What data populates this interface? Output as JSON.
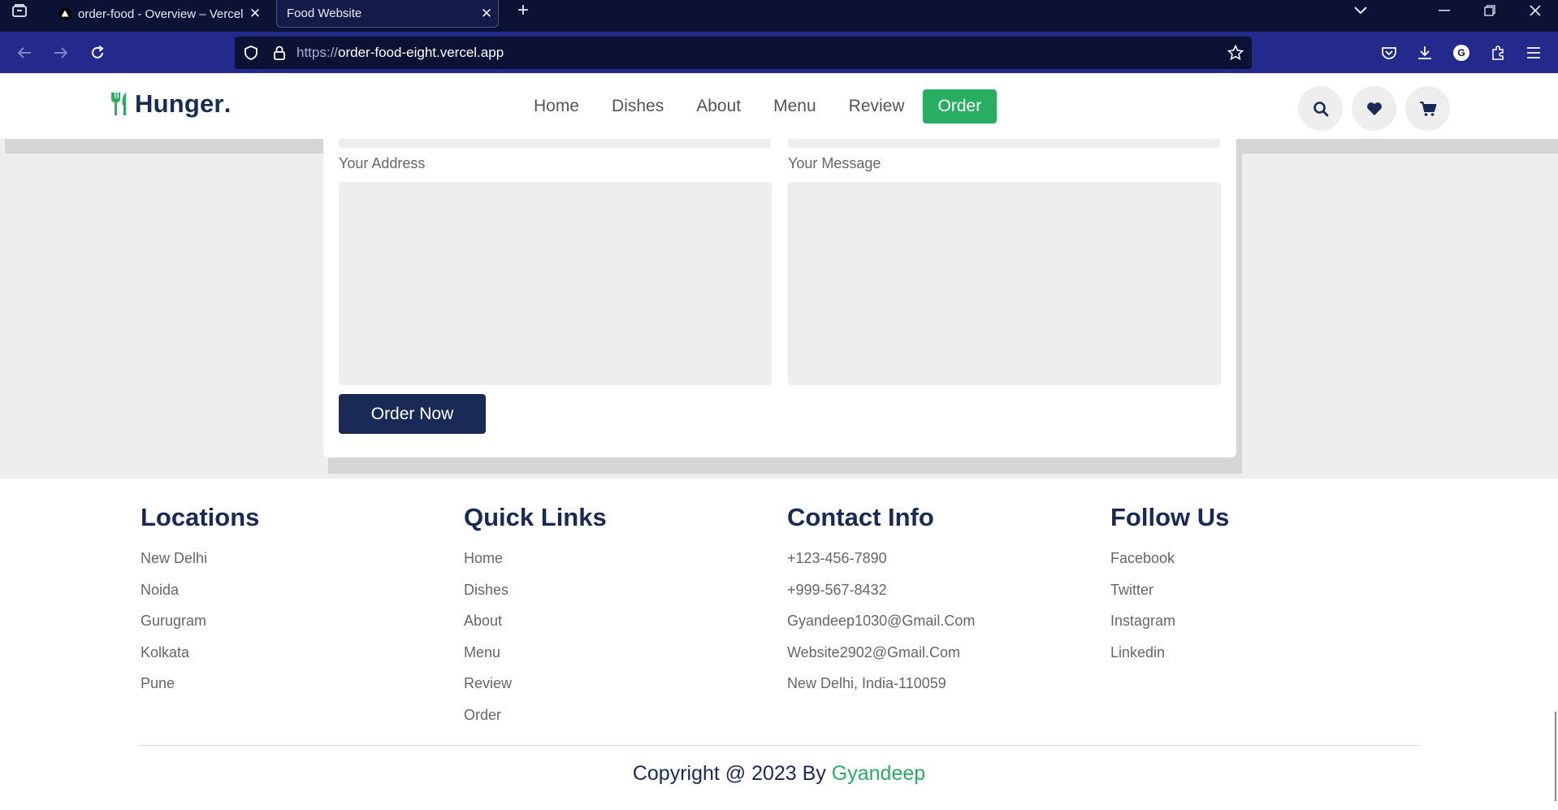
{
  "browser": {
    "tabs": [
      {
        "title": "order-food - Overview – Vercel",
        "active": false
      },
      {
        "title": "Food Website",
        "active": true
      }
    ],
    "url_scheme": "https://",
    "url_host": "order-food-eight.vercel.app"
  },
  "site": {
    "logo_text": "Hunger",
    "logo_dot": ".",
    "nav": [
      "Home",
      "Dishes",
      "About",
      "Menu",
      "Review"
    ],
    "nav_active": "Order",
    "header_icons": [
      "search-icon",
      "heart-icon",
      "cart-icon"
    ]
  },
  "order_form": {
    "address_label": "Your Address",
    "message_label": "Your Message",
    "address_value": "",
    "message_value": "",
    "submit_label": "Order Now"
  },
  "footer": {
    "locations": {
      "title": "Locations",
      "items": [
        "New Delhi",
        "Noida",
        "Gurugram",
        "Kolkata",
        "Pune"
      ]
    },
    "quick_links": {
      "title": "Quick Links",
      "items": [
        "Home",
        "Dishes",
        "About",
        "Menu",
        "Review",
        "Order"
      ]
    },
    "contact": {
      "title": "Contact Info",
      "items": [
        "+123-456-7890",
        "+999-567-8432",
        "Gyandeep1030@Gmail.Com",
        "Website2902@Gmail.Com",
        "New Delhi, India-110059"
      ]
    },
    "follow": {
      "title": "Follow Us",
      "items": [
        "Facebook",
        "Twitter",
        "Instagram",
        "Linkedin"
      ]
    },
    "credit_prefix": "Copyright @ 2023 By ",
    "credit_author": "Gyandeep"
  },
  "colors": {
    "brand_green": "#27ae60",
    "brand_navy": "#192a56",
    "browser_tabbar": "#0c1233",
    "browser_toolbar": "#232a8c"
  }
}
